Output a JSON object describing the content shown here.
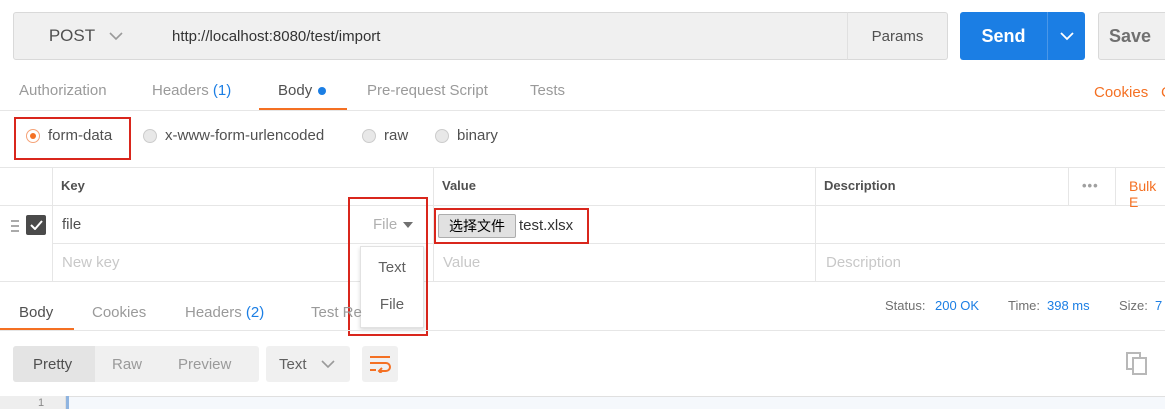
{
  "request": {
    "method": "POST",
    "url": "http://localhost:8080/test/import",
    "params_label": "Params",
    "send_label": "Send",
    "save_label": "Save"
  },
  "request_tabs": {
    "authorization": "Authorization",
    "headers": "Headers",
    "headers_count": "(1)",
    "body": "Body",
    "prerequest": "Pre-request Script",
    "tests": "Tests",
    "cookies_link": "Cookies",
    "cut_link": "C"
  },
  "body_types": {
    "form_data": "form-data",
    "urlencoded": "x-www-form-urlencoded",
    "raw": "raw",
    "binary": "binary",
    "selected": "form-data"
  },
  "table": {
    "col_key": "Key",
    "col_value": "Value",
    "col_description": "Description",
    "more": "•••",
    "bulk_edit": "Bulk E",
    "row": {
      "key": "file",
      "type": "File",
      "file_button": "选择文件",
      "file_name": "test.xlsx",
      "checked": true
    },
    "new_row": {
      "key_placeholder": "New key",
      "value_placeholder": "Value",
      "description_placeholder": "Description"
    },
    "type_dropdown": [
      "Text",
      "File"
    ]
  },
  "response": {
    "tabs": {
      "body": "Body",
      "cookies": "Cookies",
      "headers": "Headers",
      "headers_count": "(2)",
      "test_results": "Test Re"
    },
    "status_label": "Status:",
    "status_value": "200 OK",
    "time_label": "Time:",
    "time_value": "398 ms",
    "size_label": "Size:",
    "size_value": "7",
    "view_modes": [
      "Pretty",
      "Raw",
      "Preview"
    ],
    "active_view": "Pretty",
    "format": "Text",
    "line_number": "1"
  },
  "colors": {
    "accent_orange": "#f47023",
    "send_blue": "#1b7ee4",
    "highlight_red": "#d9261c"
  }
}
